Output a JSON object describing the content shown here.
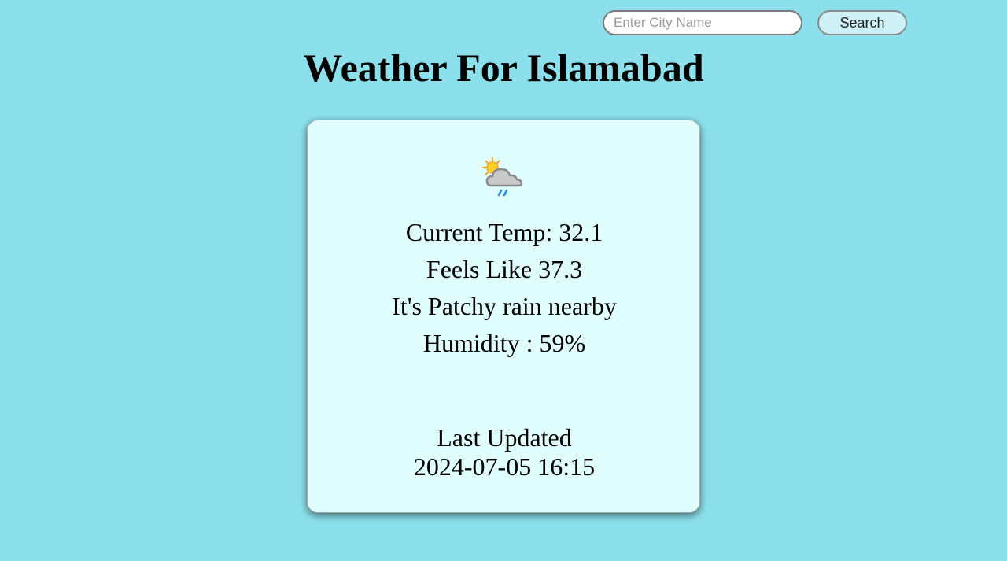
{
  "search": {
    "placeholder": "Enter City Name",
    "value": "",
    "button_label": "Search"
  },
  "page_title": "Weather For Islamabad",
  "weather": {
    "icon": "sun-behind-rain-cloud-icon",
    "current_temp": "Current Temp: 32.1",
    "feels_like": "Feels Like 37.3",
    "condition": "It's Patchy rain nearby",
    "humidity": "Humidity : 59%",
    "last_updated_label": "Last Updated",
    "last_updated_time": "2024-07-05 16:15"
  },
  "colors": {
    "background": "#8ce0ec",
    "card": "#e1feff",
    "button": "#cdf1f6"
  }
}
